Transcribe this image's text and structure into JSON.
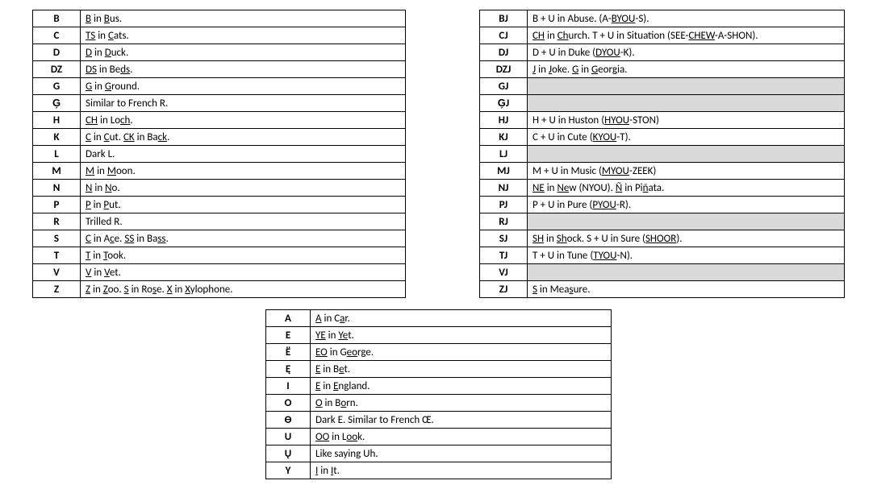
{
  "table1": [
    {
      "sym": "B",
      "parts": [
        {
          "t": "B",
          "u": 1
        },
        {
          "t": " in "
        },
        {
          "t": "B",
          "u": 1
        },
        {
          "t": "us."
        }
      ]
    },
    {
      "sym": "C",
      "parts": [
        {
          "t": "TS",
          "u": 1
        },
        {
          "t": " in "
        },
        {
          "t": "C",
          "u": 1
        },
        {
          "t": "ats."
        }
      ]
    },
    {
      "sym": "D",
      "parts": [
        {
          "t": "D",
          "u": 1
        },
        {
          "t": " in "
        },
        {
          "t": "D",
          "u": 1
        },
        {
          "t": "uck."
        }
      ]
    },
    {
      "sym": "DZ",
      "parts": [
        {
          "t": "DS",
          "u": 1
        },
        {
          "t": " in Be"
        },
        {
          "t": "ds",
          "u": 1
        },
        {
          "t": "."
        }
      ]
    },
    {
      "sym": "G",
      "parts": [
        {
          "t": "G",
          "u": 1
        },
        {
          "t": " in "
        },
        {
          "t": "G",
          "u": 1
        },
        {
          "t": "round."
        }
      ]
    },
    {
      "sym": "G̗",
      "parts": [
        {
          "t": "Similar to French R."
        }
      ]
    },
    {
      "sym": "H",
      "parts": [
        {
          "t": "CH",
          "u": 1
        },
        {
          "t": " in Lo"
        },
        {
          "t": "ch",
          "u": 1
        },
        {
          "t": "."
        }
      ]
    },
    {
      "sym": "K",
      "parts": [
        {
          "t": "C",
          "u": 1
        },
        {
          "t": " in "
        },
        {
          "t": "C",
          "u": 1
        },
        {
          "t": "ut. "
        },
        {
          "t": "CK",
          "u": 1
        },
        {
          "t": " in Ba"
        },
        {
          "t": "ck",
          "u": 1
        },
        {
          "t": "."
        }
      ]
    },
    {
      "sym": "L",
      "parts": [
        {
          "t": "Dark L."
        }
      ]
    },
    {
      "sym": "M",
      "parts": [
        {
          "t": "M",
          "u": 1
        },
        {
          "t": " in "
        },
        {
          "t": "M",
          "u": 1
        },
        {
          "t": "oon."
        }
      ]
    },
    {
      "sym": "N",
      "parts": [
        {
          "t": "N",
          "u": 1
        },
        {
          "t": " in "
        },
        {
          "t": "N",
          "u": 1
        },
        {
          "t": "o."
        }
      ]
    },
    {
      "sym": "P",
      "parts": [
        {
          "t": "P",
          "u": 1
        },
        {
          "t": " in "
        },
        {
          "t": "P",
          "u": 1
        },
        {
          "t": "ut."
        }
      ]
    },
    {
      "sym": "R",
      "parts": [
        {
          "t": "Trilled R."
        }
      ]
    },
    {
      "sym": "S",
      "parts": [
        {
          "t": "C",
          "u": 1
        },
        {
          "t": " in A"
        },
        {
          "t": "c",
          "u": 1
        },
        {
          "t": "e. "
        },
        {
          "t": "SS",
          "u": 1
        },
        {
          "t": " in Ba"
        },
        {
          "t": "ss",
          "u": 1
        },
        {
          "t": "."
        }
      ]
    },
    {
      "sym": "T",
      "parts": [
        {
          "t": "T",
          "u": 1
        },
        {
          "t": " in "
        },
        {
          "t": "T",
          "u": 1
        },
        {
          "t": "ook."
        }
      ]
    },
    {
      "sym": "V",
      "parts": [
        {
          "t": "V",
          "u": 1
        },
        {
          "t": " in "
        },
        {
          "t": "V",
          "u": 1
        },
        {
          "t": "et."
        }
      ]
    },
    {
      "sym": "Z",
      "parts": [
        {
          "t": "Z",
          "u": 1
        },
        {
          "t": " in "
        },
        {
          "t": "Z",
          "u": 1
        },
        {
          "t": "oo. "
        },
        {
          "t": "S",
          "u": 1
        },
        {
          "t": " in Ro"
        },
        {
          "t": "s",
          "u": 1
        },
        {
          "t": "e. "
        },
        {
          "t": "X",
          "u": 1
        },
        {
          "t": " in "
        },
        {
          "t": "X",
          "u": 1
        },
        {
          "t": "ylophone."
        }
      ]
    }
  ],
  "table2": [
    {
      "sym": "BJ",
      "parts": [
        {
          "t": "B + U in Abuse. (A-"
        },
        {
          "t": "BYOU",
          "u": 1
        },
        {
          "t": "-S)."
        }
      ]
    },
    {
      "sym": "CJ",
      "parts": [
        {
          "t": "CH",
          "u": 1
        },
        {
          "t": " in "
        },
        {
          "t": "Ch",
          "u": 1
        },
        {
          "t": "urch. T + U in Situation (SEE-"
        },
        {
          "t": "CHEW",
          "u": 1
        },
        {
          "t": "-A-SHON)."
        }
      ]
    },
    {
      "sym": "DJ",
      "parts": [
        {
          "t": "D + U in Duke ("
        },
        {
          "t": "DYOU",
          "u": 1
        },
        {
          "t": "-K)."
        }
      ]
    },
    {
      "sym": "DZJ",
      "parts": [
        {
          "t": "J",
          "u": 1
        },
        {
          "t": " in "
        },
        {
          "t": "J",
          "u": 1
        },
        {
          "t": "oke. "
        },
        {
          "t": "G",
          "u": 1
        },
        {
          "t": " in "
        },
        {
          "t": "G",
          "u": 1
        },
        {
          "t": "eorgia."
        }
      ]
    },
    {
      "sym": "GJ",
      "empty": true
    },
    {
      "sym": "G̗J",
      "empty": true
    },
    {
      "sym": "HJ",
      "parts": [
        {
          "t": "H + U in Huston ("
        },
        {
          "t": "HYOU",
          "u": 1
        },
        {
          "t": "-STON)"
        }
      ]
    },
    {
      "sym": "KJ",
      "parts": [
        {
          "t": "C + U in Cute ("
        },
        {
          "t": "KYOU",
          "u": 1
        },
        {
          "t": "-T)."
        }
      ]
    },
    {
      "sym": "LJ",
      "empty": true
    },
    {
      "sym": "MJ",
      "parts": [
        {
          "t": "M + U in Music ("
        },
        {
          "t": "MYOU",
          "u": 1
        },
        {
          "t": "-ZEEK)"
        }
      ]
    },
    {
      "sym": "NJ",
      "parts": [
        {
          "t": "NE",
          "u": 1
        },
        {
          "t": " in "
        },
        {
          "t": "Ne",
          "u": 1
        },
        {
          "t": "w (NYOU). "
        },
        {
          "t": "Ñ",
          "u": 1
        },
        {
          "t": " in Pi"
        },
        {
          "t": "ñ",
          "u": 1
        },
        {
          "t": "ata."
        }
      ]
    },
    {
      "sym": "PJ",
      "parts": [
        {
          "t": "P + U in Pure ("
        },
        {
          "t": "PYOU",
          "u": 1
        },
        {
          "t": "-R)."
        }
      ]
    },
    {
      "sym": "RJ",
      "empty": true
    },
    {
      "sym": "SJ",
      "parts": [
        {
          "t": "SH",
          "u": 1
        },
        {
          "t": " in "
        },
        {
          "t": "Sh",
          "u": 1
        },
        {
          "t": "ock. S + U in Sure ("
        },
        {
          "t": "SHOOR",
          "u": 1
        },
        {
          "t": ")."
        }
      ]
    },
    {
      "sym": "TJ",
      "parts": [
        {
          "t": "T + U in Tune ("
        },
        {
          "t": "TYOU",
          "u": 1
        },
        {
          "t": "-N)."
        }
      ]
    },
    {
      "sym": "VJ",
      "empty": true
    },
    {
      "sym": "ZJ",
      "parts": [
        {
          "t": "S",
          "u": 1
        },
        {
          "t": " in Mea"
        },
        {
          "t": "s",
          "u": 1
        },
        {
          "t": "ure."
        }
      ]
    }
  ],
  "table3": [
    {
      "sym": "A",
      "parts": [
        {
          "t": "A",
          "u": 1
        },
        {
          "t": " in C"
        },
        {
          "t": "a",
          "u": 1
        },
        {
          "t": "r."
        }
      ]
    },
    {
      "sym": "E",
      "parts": [
        {
          "t": "YE",
          "u": 1
        },
        {
          "t": " in "
        },
        {
          "t": "Ye",
          "u": 1
        },
        {
          "t": "t."
        }
      ]
    },
    {
      "sym": "Ë",
      "parts": [
        {
          "t": "EO",
          "u": 1
        },
        {
          "t": " in G"
        },
        {
          "t": "eo",
          "u": 1
        },
        {
          "t": "rge."
        }
      ]
    },
    {
      "sym": "Ę",
      "parts": [
        {
          "t": "E",
          "u": 1
        },
        {
          "t": " in B"
        },
        {
          "t": "e",
          "u": 1
        },
        {
          "t": "t."
        }
      ]
    },
    {
      "sym": "I",
      "parts": [
        {
          "t": "E",
          "u": 1
        },
        {
          "t": " in "
        },
        {
          "t": "E",
          "u": 1
        },
        {
          "t": "ngland."
        }
      ]
    },
    {
      "sym": "O",
      "parts": [
        {
          "t": "O",
          "u": 1
        },
        {
          "t": " in B"
        },
        {
          "t": "o",
          "u": 1
        },
        {
          "t": "rn."
        }
      ]
    },
    {
      "sym": "Ө",
      "parts": [
        {
          "t": "Dark E. Similar to French Œ."
        }
      ]
    },
    {
      "sym": "U",
      "parts": [
        {
          "t": "OO",
          "u": 1
        },
        {
          "t": " in L"
        },
        {
          "t": "oo",
          "u": 1
        },
        {
          "t": "k."
        }
      ]
    },
    {
      "sym": "Ų",
      "parts": [
        {
          "t": "Like saying Uh."
        }
      ]
    },
    {
      "sym": "Y",
      "parts": [
        {
          "t": "I",
          "u": 1
        },
        {
          "t": " in "
        },
        {
          "t": "I",
          "u": 1
        },
        {
          "t": "t."
        }
      ]
    }
  ]
}
